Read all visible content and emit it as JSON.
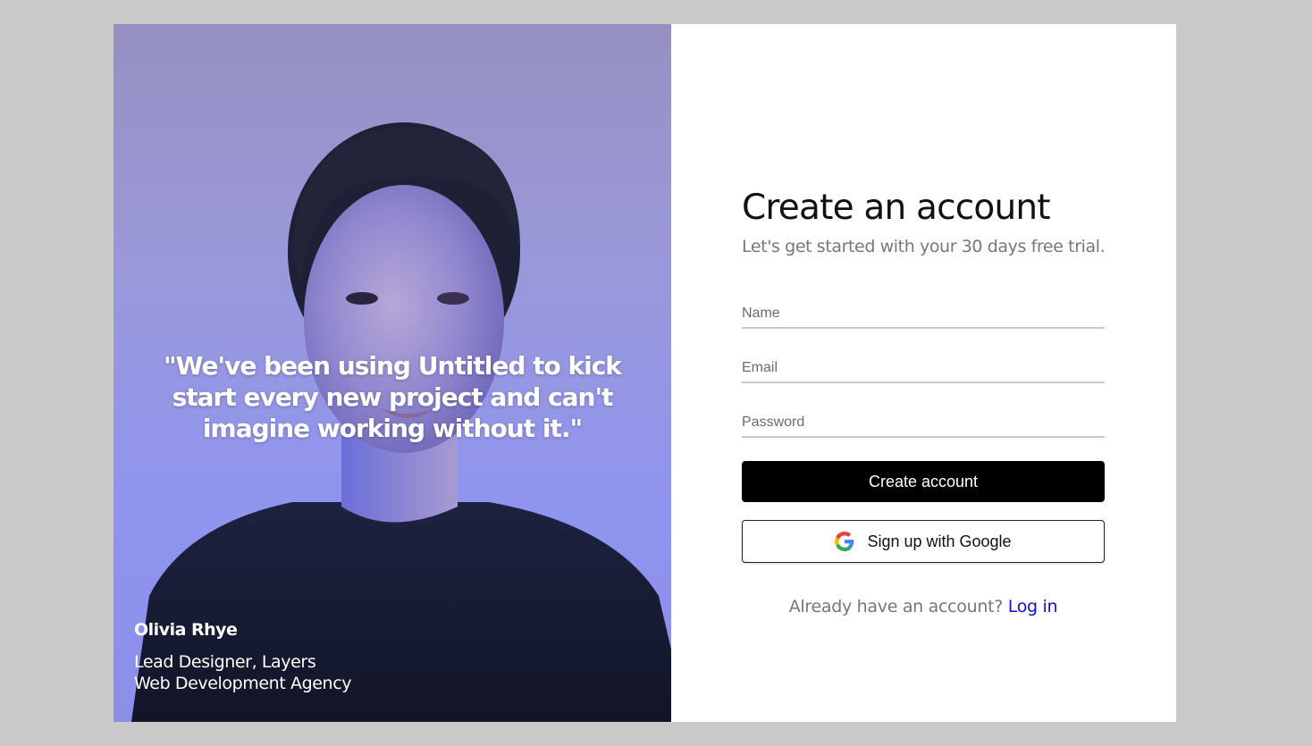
{
  "testimonial": {
    "quote": "\"We've been using Untitled to kick start every new project and can't imagine working without it.\"",
    "name": "Olivia Rhye",
    "role_line1": "Lead Designer, Layers",
    "role_line2": "Web Development Agency"
  },
  "form": {
    "title": "Create an account",
    "subtitle": "Let's get started with your 30 days free trial.",
    "name_placeholder": "Name",
    "email_placeholder": "Email",
    "password_placeholder": "Password",
    "create_button": "Create account",
    "google_button": "Sign up with Google",
    "login_prompt": "Already have an account?",
    "login_link": "Log in"
  },
  "icons": {
    "google": "google-g-icon"
  },
  "colors": {
    "page_bg": "#c9c9c9",
    "primary_button": "#000000",
    "link": "#1010d0",
    "hero_tint": "#8f94ef"
  }
}
